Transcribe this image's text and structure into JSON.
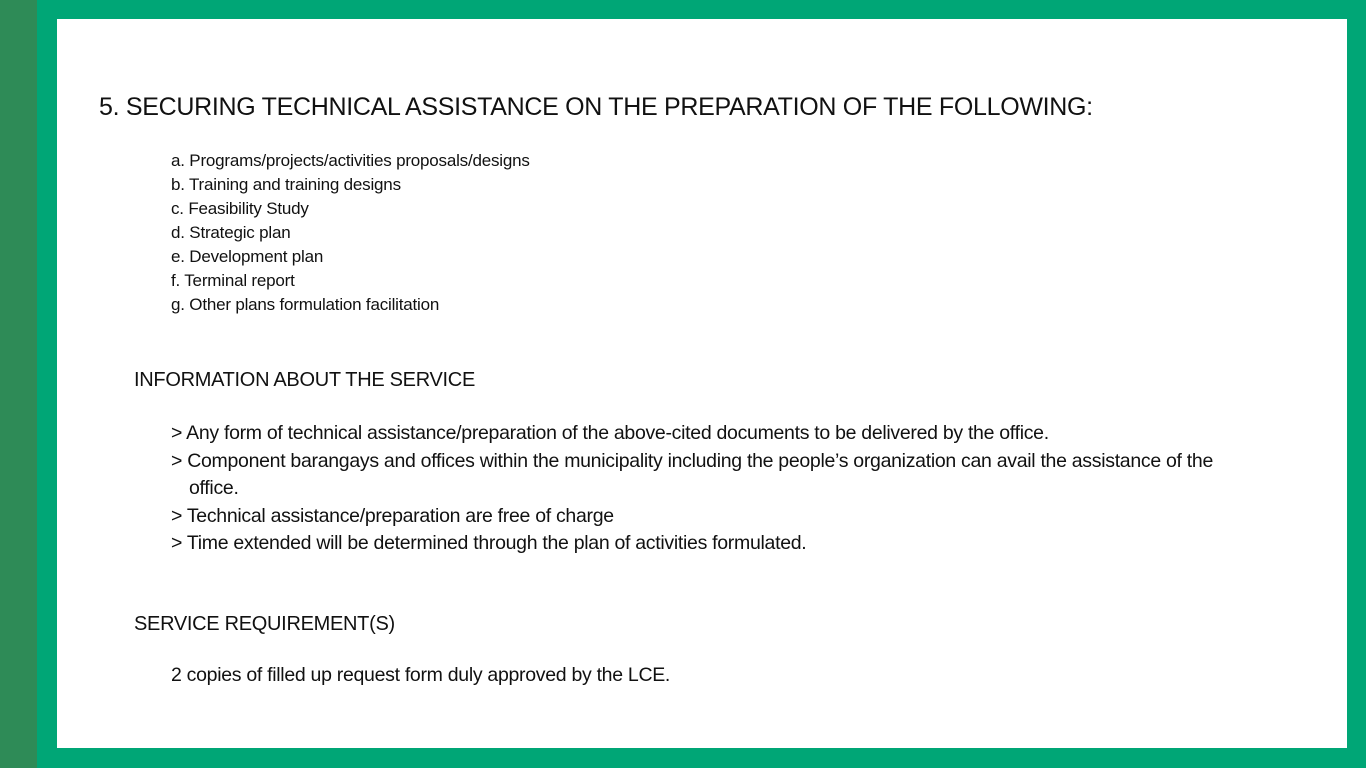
{
  "colors": {
    "frame": "#00a676",
    "left_stripe": "#2e8b57",
    "page": "#ffffff",
    "text": "#111111"
  },
  "title": "5. SECURING TECHNICAL ASSISTANCE ON THE PREPARATION OF THE FOLLOWING:",
  "documents": [
    "a. Programs/projects/activities proposals/designs",
    "b. Training and training designs",
    "c. Feasibility Study",
    "d. Strategic plan",
    "e. Development plan",
    "f. Terminal report",
    "g. Other plans formulation facilitation"
  ],
  "info_section": {
    "heading": "INFORMATION ABOUT THE SERVICE",
    "items": [
      "> Any form of technical assistance/preparation of the above-cited documents to be delivered by the office.",
      "> Component barangays and offices within the municipality including the people’s organization can avail the assistance of the office.",
      "> Technical assistance/preparation are free of charge",
      "> Time extended will be determined through the plan of activities formulated."
    ]
  },
  "requirements_section": {
    "heading": "SERVICE REQUIREMENT(S)",
    "text": "2 copies of filled up request form duly approved by the LCE."
  }
}
